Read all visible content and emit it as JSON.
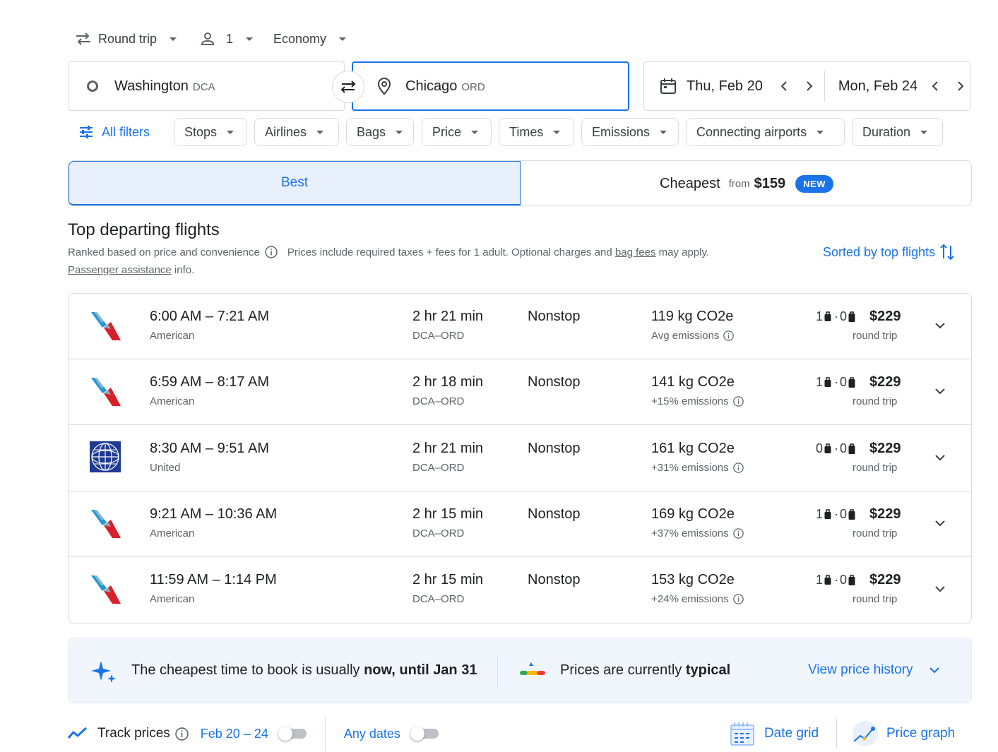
{
  "trip_options": {
    "trip_type": "Round trip",
    "passengers": "1",
    "cabin": "Economy"
  },
  "search": {
    "origin_city": "Washington",
    "origin_code": "DCA",
    "destination_city": "Chicago",
    "destination_code": "ORD",
    "depart_date": "Thu, Feb 20",
    "return_date": "Mon, Feb 24"
  },
  "filters": {
    "all_filters": "All filters",
    "chips": [
      "Stops",
      "Airlines",
      "Bags",
      "Price",
      "Times",
      "Emissions",
      "Connecting airports",
      "Duration"
    ]
  },
  "tabs": {
    "best": "Best",
    "cheapest": "Cheapest",
    "cheapest_from": "from",
    "cheapest_price": "$159",
    "new_badge": "NEW"
  },
  "results": {
    "heading": "Top departing flights",
    "ranked_note": "Ranked based on price and convenience",
    "taxes_note_prefix": "Prices include required taxes + fees for 1 adult. Optional charges and ",
    "bag_fees_link": "bag fees",
    "taxes_note_suffix": " may apply.",
    "passenger_link": "Passenger assistance",
    "passenger_suffix": " info.",
    "sorted_label": "Sorted by top flights"
  },
  "flights": [
    {
      "times": "6:00 AM – 7:21 AM",
      "airline": "American",
      "duration": "2 hr 21 min",
      "route": "DCA–ORD",
      "stops": "Nonstop",
      "co2": "119 kg CO2e",
      "emissions": "Avg emissions",
      "carry_on": "1",
      "checked": "0",
      "price": "$229",
      "price_note": "round trip",
      "logo": "american-airlines-logo"
    },
    {
      "times": "6:59 AM – 8:17 AM",
      "airline": "American",
      "duration": "2 hr 18 min",
      "route": "DCA–ORD",
      "stops": "Nonstop",
      "co2": "141 kg CO2e",
      "emissions": "+15% emissions",
      "carry_on": "1",
      "checked": "0",
      "price": "$229",
      "price_note": "round trip",
      "logo": "american-airlines-logo"
    },
    {
      "times": "8:30 AM – 9:51 AM",
      "airline": "United",
      "duration": "2 hr 21 min",
      "route": "DCA–ORD",
      "stops": "Nonstop",
      "co2": "161 kg CO2e",
      "emissions": "+31% emissions",
      "carry_on": "0",
      "checked": "0",
      "price": "$229",
      "price_note": "round trip",
      "logo": "united-airlines-logo"
    },
    {
      "times": "9:21 AM – 10:36 AM",
      "airline": "American",
      "duration": "2 hr 15 min",
      "route": "DCA–ORD",
      "stops": "Nonstop",
      "co2": "169 kg CO2e",
      "emissions": "+37% emissions",
      "carry_on": "1",
      "checked": "0",
      "price": "$229",
      "price_note": "round trip",
      "logo": "american-airlines-logo"
    },
    {
      "times": "11:59 AM – 1:14 PM",
      "airline": "American",
      "duration": "2 hr 15 min",
      "route": "DCA–ORD",
      "stops": "Nonstop",
      "co2": "153 kg CO2e",
      "emissions": "+24% emissions",
      "carry_on": "1",
      "checked": "0",
      "price": "$229",
      "price_note": "round trip",
      "logo": "american-airlines-logo"
    }
  ],
  "insights": {
    "book_prefix": "The cheapest time to book is usually ",
    "book_bold": "now, until Jan 31",
    "prices_prefix": "Prices are currently ",
    "prices_bold": "typical",
    "view_history": "View price history"
  },
  "bottom_bar": {
    "track_prices": "Track prices",
    "date_range": "Feb 20 – 24",
    "any_dates": "Any dates",
    "date_grid": "Date grid",
    "price_graph": "Price graph"
  },
  "colors": {
    "accent": "#1a73e8",
    "tab_selected_bg": "#e8f0fe",
    "insight_bg": "#f1f6fd"
  }
}
